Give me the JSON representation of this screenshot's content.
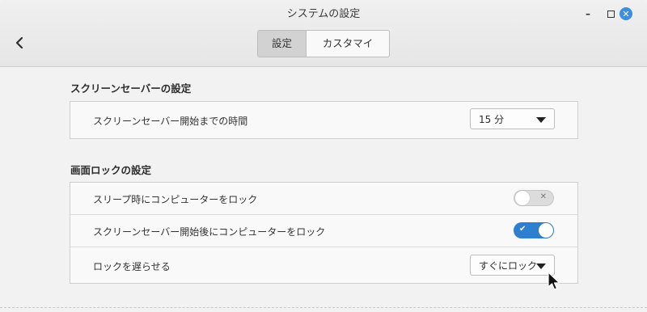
{
  "window": {
    "title": "システムの設定"
  },
  "header": {
    "tabs": [
      {
        "label": "設定",
        "active": true
      },
      {
        "label": "カスタマイズ",
        "active": false
      }
    ]
  },
  "screensaver": {
    "section_title": "スクリーンセーバーの設定",
    "delay_label": "スクリーンセーバー開始までの時間",
    "delay_value": "15 分"
  },
  "lock": {
    "section_title": "画面ロックの設定",
    "sleep_lock_label": "スリープ時にコンピューターをロック",
    "sleep_lock_on": false,
    "saver_lock_label": "スクリーンセーバー開始後にコンピューターをロック",
    "saver_lock_on": true,
    "delay_label": "ロックを遅らせる",
    "delay_value": "すぐにロック"
  },
  "colors": {
    "accent": "#2f7fd1",
    "close_button": "#3e8ee0"
  }
}
